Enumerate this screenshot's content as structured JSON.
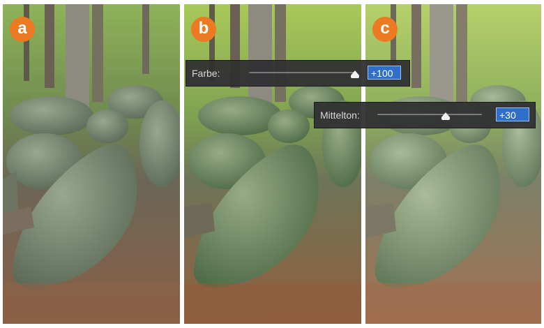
{
  "panels": [
    {
      "badge": "a"
    },
    {
      "badge": "b"
    },
    {
      "badge": "c"
    }
  ],
  "controls": {
    "farbe": {
      "label": "Farbe:",
      "value": "+100",
      "level": 1.0
    },
    "mittelton": {
      "label": "Mittelton:",
      "value": "+30",
      "level": 0.65
    }
  },
  "colors": {
    "badge": "#ec7a22",
    "value_field": "#2f6fc9",
    "bar_background": "#303032"
  }
}
